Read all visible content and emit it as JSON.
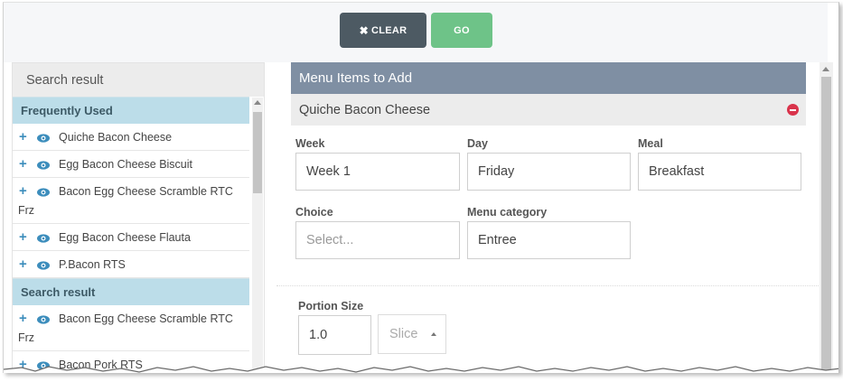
{
  "toolbar": {
    "clear_label": "CLEAR",
    "go_label": "GO"
  },
  "left_panel": {
    "header": "Search result",
    "frequently_used_label": "Frequently Used",
    "frequent_items": [
      {
        "line1": "Quiche Bacon Cheese",
        "line2": ""
      },
      {
        "line1": "Egg Bacon Cheese Biscuit",
        "line2": ""
      },
      {
        "line1": "Bacon Egg Cheese Scramble RTC",
        "line2": "Frz"
      },
      {
        "line1": "Egg Bacon Cheese Flauta",
        "line2": ""
      },
      {
        "line1": "P.Bacon RTS",
        "line2": ""
      }
    ],
    "search_result_label": "Search result",
    "search_items": [
      {
        "line1": "Bacon Egg Cheese Scramble RTC",
        "line2": "Frz"
      },
      {
        "line1": "Bacon Pork RTS",
        "line2": ""
      }
    ]
  },
  "right_panel": {
    "header": "Menu Items to Add",
    "item_name": "Quiche Bacon Cheese",
    "week_label": "Week",
    "week_value": "Week 1",
    "day_label": "Day",
    "day_value": "Friday",
    "meal_label": "Meal",
    "meal_value": "Breakfast",
    "choice_label": "Choice",
    "choice_placeholder": "Select...",
    "category_label": "Menu category",
    "category_value": "Entree",
    "portion_label": "Portion Size",
    "portion_value": "1.0",
    "unit_value": "Slice"
  },
  "colors": {
    "clear_button": "#4d5a63",
    "go_button": "#6ec388",
    "section_header": "#bcdde9",
    "menu_header": "#7f8fa3",
    "remove_icon": "#d9334b",
    "icon_blue": "#3c8dbc"
  }
}
